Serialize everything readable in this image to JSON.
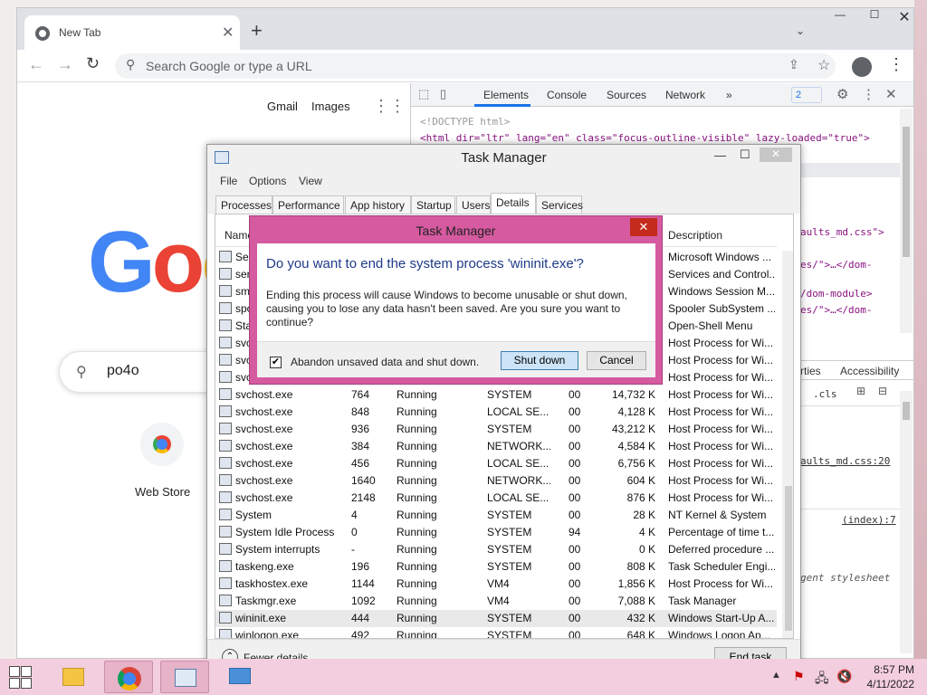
{
  "browser": {
    "tab_title": "New Tab",
    "new_tab": "+",
    "tabs_menu": "⌄",
    "minimize": "—",
    "maximize": "☐",
    "close": "✕",
    "omnibox_placeholder": "Search Google or type a URL",
    "back": "←",
    "forward": "→",
    "reload": "↻",
    "menu": "⋮"
  },
  "google": {
    "gmail": "Gmail",
    "images": "Images",
    "logo": "Goo",
    "search_value": "po4o",
    "shortcut_label": "Web Store",
    "logo_colors": [
      "#4285f4",
      "#ea4335",
      "#fbbc05"
    ]
  },
  "devtools": {
    "tabs": [
      "Elements",
      "Console",
      "Sources",
      "Network",
      "»"
    ],
    "issues_count": "2",
    "code_lines": [
      "<!DOCTYPE html>",
      "<html dir=\"ltr\" lang=\"en\" class=\"focus-outline-visible\" lazy-loaded=\"true\">"
    ],
    "right_snippets": [
      "aults_md.css\">",
      "es/\">…</dom-",
      "/dom-module>",
      "es/\">…</dom-"
    ],
    "pane_tabs": [
      "rties",
      "Accessibility"
    ],
    "styles_toolbar": [
      ".cls"
    ],
    "style_snippets": [
      "aults_md.css:20",
      "(index):7",
      "gent stylesheet"
    ]
  },
  "task_manager": {
    "title": "Task Manager",
    "menu": [
      "File",
      "Options",
      "View"
    ],
    "tabs": [
      "Processes",
      "Performance",
      "App history",
      "Startup",
      "Users",
      "Details",
      "Services"
    ],
    "active_tab": "Details",
    "columns": {
      "name": "Name",
      "description": "Description"
    },
    "rows": [
      {
        "name": "Sea",
        "pid": "",
        "status": "",
        "user": "",
        "cpu": "",
        "mem": "",
        "desc": "Microsoft Windows ..."
      },
      {
        "name": "serv",
        "pid": "",
        "status": "",
        "user": "",
        "cpu": "",
        "mem": "",
        "desc": "Services and Control..."
      },
      {
        "name": "sms",
        "pid": "",
        "status": "",
        "user": "",
        "cpu": "",
        "mem": "",
        "desc": "Windows Session M..."
      },
      {
        "name": "spo",
        "pid": "",
        "status": "",
        "user": "",
        "cpu": "",
        "mem": "",
        "desc": "Spooler SubSystem ..."
      },
      {
        "name": "Sta",
        "pid": "",
        "status": "",
        "user": "",
        "cpu": "",
        "mem": "",
        "desc": "Open-Shell Menu"
      },
      {
        "name": "svc",
        "pid": "",
        "status": "",
        "user": "",
        "cpu": "",
        "mem": "",
        "desc": "Host Process for Wi..."
      },
      {
        "name": "svc",
        "pid": "",
        "status": "",
        "user": "",
        "cpu": "",
        "mem": "",
        "desc": "Host Process for Wi..."
      },
      {
        "name": "svc",
        "pid": "",
        "status": "",
        "user": "",
        "cpu": "",
        "mem": "",
        "desc": "Host Process for Wi..."
      },
      {
        "name": "svchost.exe",
        "pid": "764",
        "status": "Running",
        "user": "SYSTEM",
        "cpu": "00",
        "mem": "14,732 K",
        "desc": "Host Process for Wi..."
      },
      {
        "name": "svchost.exe",
        "pid": "848",
        "status": "Running",
        "user": "LOCAL SE...",
        "cpu": "00",
        "mem": "4,128 K",
        "desc": "Host Process for Wi..."
      },
      {
        "name": "svchost.exe",
        "pid": "936",
        "status": "Running",
        "user": "SYSTEM",
        "cpu": "00",
        "mem": "43,212 K",
        "desc": "Host Process for Wi..."
      },
      {
        "name": "svchost.exe",
        "pid": "384",
        "status": "Running",
        "user": "NETWORK...",
        "cpu": "00",
        "mem": "4,584 K",
        "desc": "Host Process for Wi..."
      },
      {
        "name": "svchost.exe",
        "pid": "456",
        "status": "Running",
        "user": "LOCAL SE...",
        "cpu": "00",
        "mem": "6,756 K",
        "desc": "Host Process for Wi..."
      },
      {
        "name": "svchost.exe",
        "pid": "1640",
        "status": "Running",
        "user": "NETWORK...",
        "cpu": "00",
        "mem": "604 K",
        "desc": "Host Process for Wi..."
      },
      {
        "name": "svchost.exe",
        "pid": "2148",
        "status": "Running",
        "user": "LOCAL SE...",
        "cpu": "00",
        "mem": "876 K",
        "desc": "Host Process for Wi..."
      },
      {
        "name": "System",
        "pid": "4",
        "status": "Running",
        "user": "SYSTEM",
        "cpu": "00",
        "mem": "28 K",
        "desc": "NT Kernel & System"
      },
      {
        "name": "System Idle Process",
        "pid": "0",
        "status": "Running",
        "user": "SYSTEM",
        "cpu": "94",
        "mem": "4 K",
        "desc": "Percentage of time t..."
      },
      {
        "name": "System interrupts",
        "pid": "-",
        "status": "Running",
        "user": "SYSTEM",
        "cpu": "00",
        "mem": "0 K",
        "desc": "Deferred procedure ..."
      },
      {
        "name": "taskeng.exe",
        "pid": "196",
        "status": "Running",
        "user": "SYSTEM",
        "cpu": "00",
        "mem": "808 K",
        "desc": "Task Scheduler Engi..."
      },
      {
        "name": "taskhostex.exe",
        "pid": "1144",
        "status": "Running",
        "user": "VM4",
        "cpu": "00",
        "mem": "1,856 K",
        "desc": "Host Process for Wi..."
      },
      {
        "name": "Taskmgr.exe",
        "pid": "1092",
        "status": "Running",
        "user": "VM4",
        "cpu": "00",
        "mem": "7,088 K",
        "desc": "Task Manager"
      },
      {
        "name": "wininit.exe",
        "pid": "444",
        "status": "Running",
        "user": "SYSTEM",
        "cpu": "00",
        "mem": "432 K",
        "desc": "Windows Start-Up A..."
      },
      {
        "name": "winlogon.exe",
        "pid": "492",
        "status": "Running",
        "user": "SYSTEM",
        "cpu": "00",
        "mem": "648 K",
        "desc": "Windows Logon Ap..."
      }
    ],
    "fewer_details": "Fewer details",
    "end_task": "End task"
  },
  "dialog": {
    "title": "Task Manager",
    "heading": "Do you want to end the system process 'wininit.exe'?",
    "body": "Ending this process will cause Windows to become unusable or shut down, causing you to lose any data hasn't been saved. Are you sure you want to continue?",
    "checkbox_label": "Abandon unsaved data and shut down.",
    "checkbox_checked": true,
    "shutdown_label": "Shut down",
    "cancel_label": "Cancel",
    "close": "✕",
    "accent_color": "#d55aa0"
  },
  "taskbar": {
    "time": "8:57 PM",
    "date": "4/11/2022",
    "tray_up": "▲"
  }
}
